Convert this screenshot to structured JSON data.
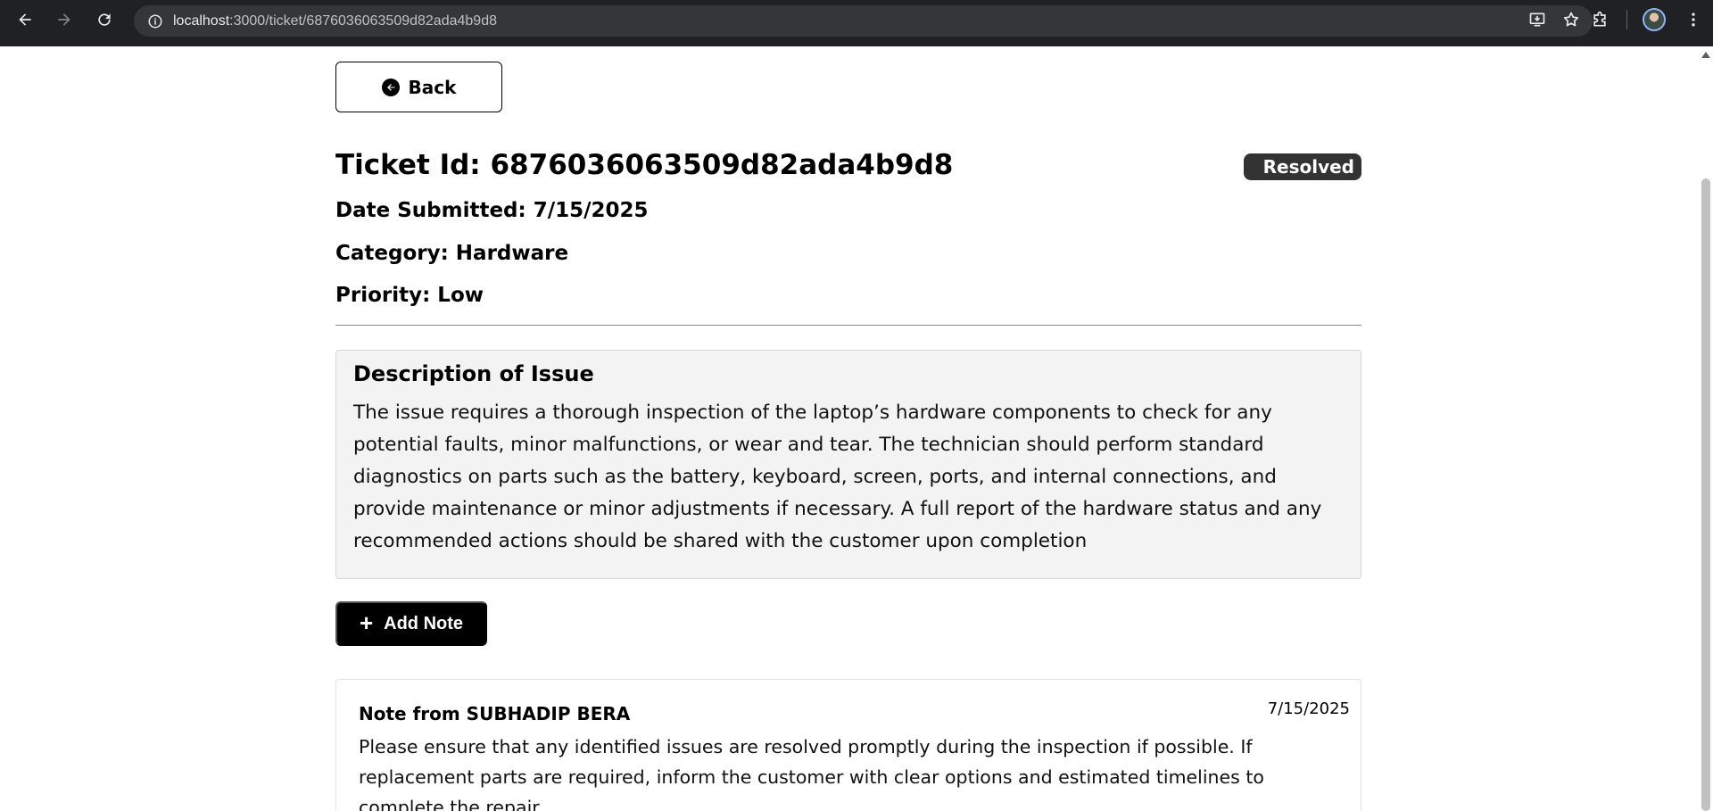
{
  "browser": {
    "url_host": "localhost",
    "url_path": ":3000/ticket/6876036063509d82ada4b9d8"
  },
  "page": {
    "back_label": "Back",
    "ticket_title": "Ticket Id: 6876036063509d82ada4b9d8",
    "status": "Resolved",
    "date_submitted": "Date Submitted: 7/15/2025",
    "category": "Category: Hardware",
    "priority": "Priority: Low",
    "description_heading": "Description of Issue",
    "description_text": "The issue requires a thorough inspection of the laptop’s hardware components to check for any potential faults, minor malfunctions, or wear and tear. The technician should perform standard diagnostics on parts such as the battery, keyboard, screen, ports, and internal connections, and provide maintenance or minor adjustments if necessary. A full report of the hardware status and any recommended actions should be shared with the customer upon completion",
    "add_note_label": "Add Note",
    "notes": [
      {
        "author": "Note from SUBHADIP BERA",
        "date": "7/15/2025",
        "text": "Please ensure that any identified issues are resolved promptly during the inspection if possible. If replacement parts are required, inform the customer with clear options and estimated timelines to complete the repair."
      }
    ]
  },
  "colors": {
    "chrome_bg": "#202124",
    "omnibox_bg": "#35363a",
    "status_badge_bg": "#333333",
    "description_bg": "#f3f3f3",
    "primary_button_bg": "#000000"
  },
  "icons": {
    "back": "arrow-left-icon",
    "forward": "arrow-right-icon",
    "reload": "reload-icon",
    "site_info": "info-icon",
    "install": "install-app-icon",
    "bookmark": "star-icon",
    "extensions": "puzzle-icon",
    "menu": "kebab-menu-icon",
    "back_button": "circle-arrow-left-icon",
    "add_note": "plus-icon"
  }
}
